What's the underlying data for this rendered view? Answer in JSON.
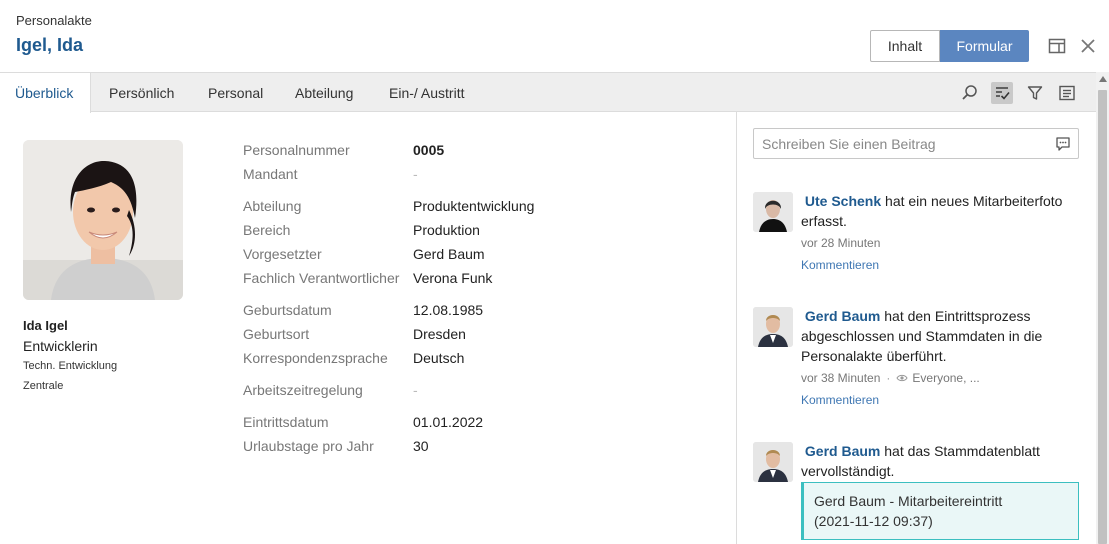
{
  "header": {
    "breadcrumb": "Personalakte",
    "title": "Igel, Ida",
    "view_toggle": {
      "inhalt": "Inhalt",
      "formular": "Formular",
      "active": "Formular"
    },
    "icons": [
      "layout-icon",
      "close-icon"
    ]
  },
  "tabs": [
    {
      "label": "Überblick",
      "active": true
    },
    {
      "label": "Persönlich"
    },
    {
      "label": "Personal"
    },
    {
      "label": "Abteilung"
    },
    {
      "label": "Ein-/ Austritt"
    }
  ],
  "toolbar_icons": [
    "search-icon",
    "checklist-icon",
    "filter-icon",
    "list-icon"
  ],
  "profile": {
    "name": "Ida Igel",
    "role": "Entwicklerin",
    "department": "Techn. Entwicklung",
    "location": "Zentrale"
  },
  "fields": [
    {
      "label": "Personalnummer",
      "value": "0005"
    },
    {
      "label": "Mandant",
      "value": "-"
    },
    {
      "label": "Abteilung",
      "value": "Produktentwicklung"
    },
    {
      "label": "Bereich",
      "value": "Produktion"
    },
    {
      "label": "Vorgesetzter",
      "value": "Gerd Baum"
    },
    {
      "label": "Fachlich Verantwortlicher",
      "value": "Verona Funk"
    },
    {
      "label": "Geburtsdatum",
      "value": "12.08.1985"
    },
    {
      "label": "Geburtsort",
      "value": "Dresden"
    },
    {
      "label": "Korrespondenzsprache",
      "value": "Deutsch"
    },
    {
      "label": "Arbeitszeitregelung",
      "value": "-"
    },
    {
      "label": "Eintrittsdatum",
      "value": "01.01.2022"
    },
    {
      "label": "Urlaubstage pro Jahr",
      "value": "30"
    }
  ],
  "feed": {
    "placeholder": "Schreiben Sie einen Beitrag",
    "items": [
      {
        "author": "Ute Schenk",
        "text_line1": "hat ein neues Mitarbeiterfoto",
        "text_line2": "erfasst.",
        "time": "vor 28 Minuten",
        "comment": "Kommentieren"
      },
      {
        "author": "Gerd Baum",
        "text_line1": "hat den Eintrittsprozess",
        "text_line2": "abgeschlossen und Stammdaten in die",
        "text_line3": "Personalakte überführt.",
        "time": "vor 38 Minuten",
        "visibility": "Everyone, ...",
        "comment": "Kommentieren"
      },
      {
        "author": "Gerd Baum",
        "text_line1": "hat das Stammdatenblatt",
        "text_line2": "vervollständigt.",
        "attachment_title": "Gerd Baum - Mitarbeitereintritt",
        "attachment_date": "(2021-11-12 09:37)"
      }
    ]
  },
  "colors": {
    "accent": "#1f5a8f",
    "button": "#5b86c0",
    "callout": "#3cbfc0"
  }
}
